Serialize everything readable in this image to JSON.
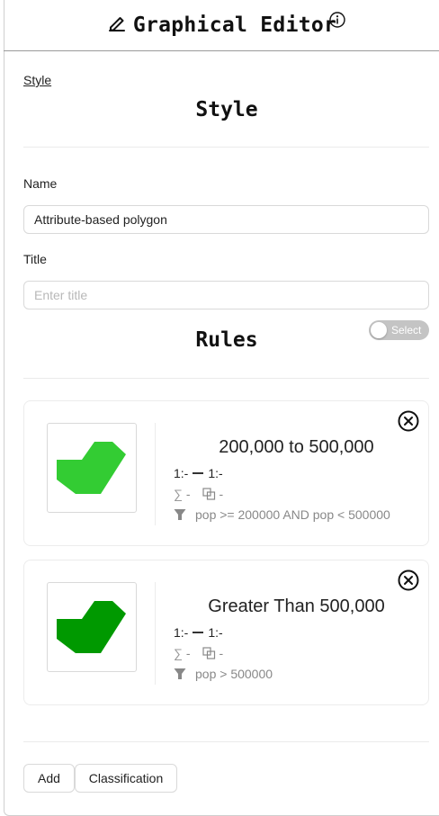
{
  "header": {
    "title": "Graphical Editor",
    "edit_icon": "pencil-icon",
    "info_icon": "info-icon"
  },
  "breadcrumb": {
    "label": "Style"
  },
  "style_section": {
    "title": "Style"
  },
  "form": {
    "name_label": "Name",
    "name_value": "Attribute-based polygon",
    "title_label": "Title",
    "title_placeholder": "Enter title",
    "title_value": ""
  },
  "rules_section": {
    "title": "Rules",
    "select_toggle_label": "Select",
    "select_toggle_on": false
  },
  "rules": [
    {
      "name": "200,000 to 500,000",
      "scale_min": "1:-",
      "scale_max": "1:-",
      "sum_value": "-",
      "overlap_value": "-",
      "filter": "pop >= 200000 AND pop < 500000",
      "fill_color": "#33cc33"
    },
    {
      "name": "Greater Than 500,000",
      "scale_min": "1:-",
      "scale_max": "1:-",
      "sum_value": "-",
      "overlap_value": "-",
      "filter": "pop > 500000",
      "fill_color": "#009900"
    }
  ],
  "symbols": {
    "sum": "∑",
    "remove_icon": "close-circle-icon",
    "funnel_icon": "funnel-icon",
    "overlap_icon": "overlap-icon"
  },
  "actions": {
    "add_label": "Add",
    "classification_label": "Classification"
  }
}
